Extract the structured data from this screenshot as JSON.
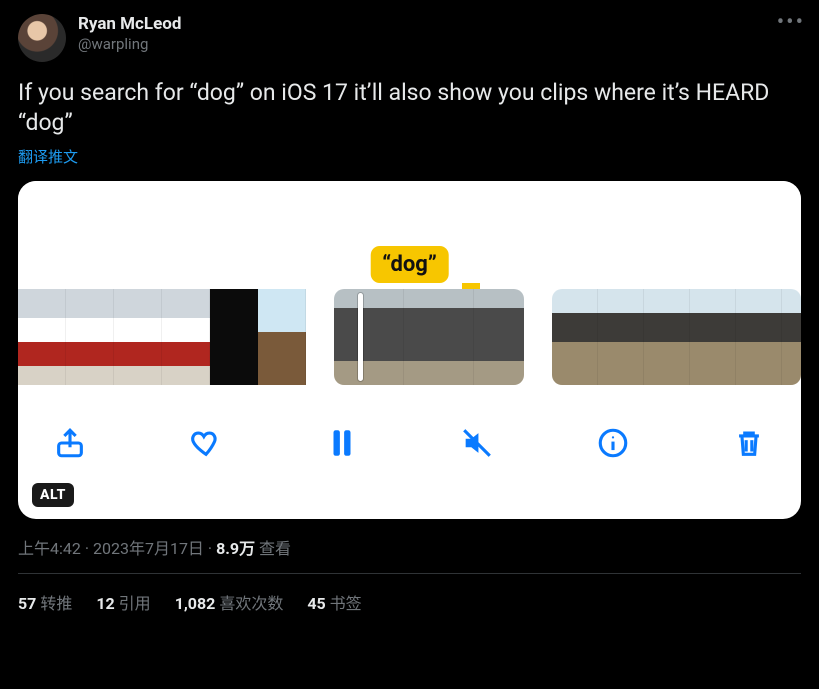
{
  "author": {
    "display_name": "Ryan McLeod",
    "handle": "@warpling"
  },
  "body": "If you search for “dog” on iOS 17 it’ll also show you clips where it’s HEARD “dog”",
  "translate_label": "翻译推文",
  "media": {
    "badge_text": "“dog”",
    "alt_label": "ALT",
    "toolbar_icons": [
      "share-icon",
      "heart-icon",
      "pause-icon",
      "mute-icon",
      "info-icon",
      "trash-icon"
    ]
  },
  "meta": {
    "time": "上午4:42",
    "date": "2023年7月17日",
    "views_num": "8.9万",
    "views_label": "查看",
    "separator": " · "
  },
  "stats": {
    "retweets_num": "57",
    "retweets_label": "转推",
    "quotes_num": "12",
    "quotes_label": "引用",
    "likes_num": "1,082",
    "likes_label": "喜欢次数",
    "bookmarks_num": "45",
    "bookmarks_label": "书签"
  }
}
